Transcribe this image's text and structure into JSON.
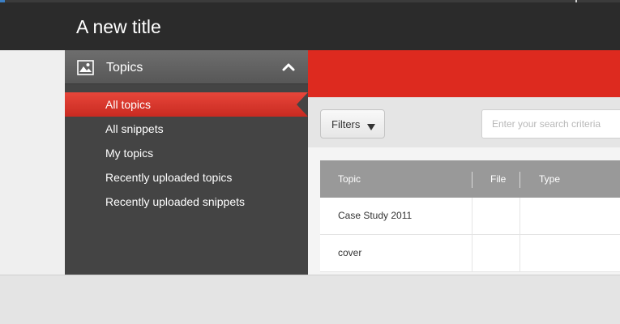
{
  "header": {
    "title": "A new title"
  },
  "sidebar": {
    "title": "Topics",
    "items": [
      {
        "label": "All topics",
        "active": true
      },
      {
        "label": "All snippets",
        "active": false
      },
      {
        "label": "My topics",
        "active": false
      },
      {
        "label": "Recently uploaded topics",
        "active": false
      },
      {
        "label": "Recently uploaded snippets",
        "active": false
      }
    ]
  },
  "filters": {
    "label": "Filters"
  },
  "search": {
    "placeholder": "Enter your search criteria",
    "value": ""
  },
  "table": {
    "columns": [
      "Topic",
      "File",
      "Type"
    ],
    "rows": [
      {
        "topic": "Case Study 2011",
        "file": "",
        "type": ""
      },
      {
        "topic": "cover",
        "file": "",
        "type": ""
      }
    ]
  },
  "colors": {
    "accent": "#dd2a1f",
    "header": "#2b2b2b",
    "sidebar": "#444444"
  }
}
